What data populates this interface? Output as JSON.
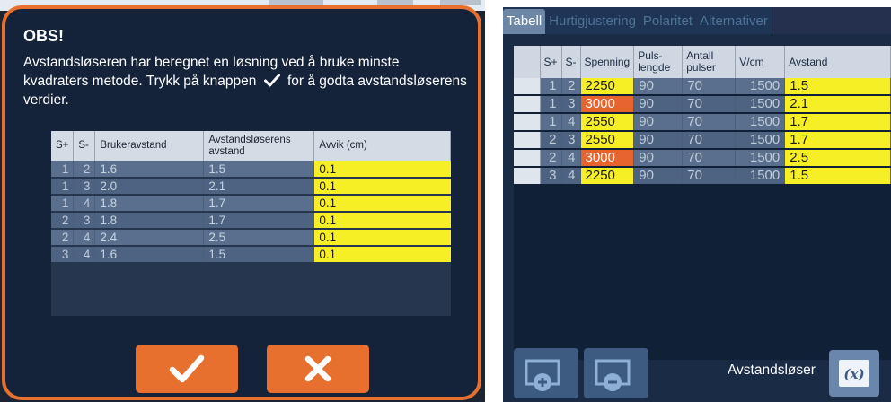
{
  "dialog": {
    "title": "OBS!",
    "message_part1": "Avstandsløseren har beregnet en løsning ved å bruke minste kvadraters metode. Trykk på knappen",
    "message_part2": "for å godta avstandsløserens verdier.",
    "table": {
      "headers": [
        "S+",
        "S-",
        "Brukeravstand",
        "Avstandsløserens avstand",
        "Avvik (cm)"
      ],
      "rows": [
        {
          "splus": "1",
          "sminus": "2",
          "user": "1.6",
          "solver": "1.5",
          "dev": "0.1"
        },
        {
          "splus": "1",
          "sminus": "3",
          "user": "2.0",
          "solver": "2.1",
          "dev": "0.1"
        },
        {
          "splus": "1",
          "sminus": "4",
          "user": "1.8",
          "solver": "1.7",
          "dev": "0.1"
        },
        {
          "splus": "2",
          "sminus": "3",
          "user": "1.8",
          "solver": "1.7",
          "dev": "0.1"
        },
        {
          "splus": "2",
          "sminus": "4",
          "user": "2.4",
          "solver": "2.5",
          "dev": "0.1"
        },
        {
          "splus": "3",
          "sminus": "4",
          "user": "1.6",
          "solver": "1.5",
          "dev": "0.1"
        }
      ]
    },
    "ok_icon": "checkmark-icon",
    "cancel_icon": "x-icon"
  },
  "app": {
    "tabs": [
      "Tabell",
      "Hurtigjustering",
      "Polaritet",
      "Alternativer"
    ],
    "active_tab": "Tabell",
    "table": {
      "headers": [
        "",
        "S+",
        "S-",
        "Spenning",
        "Puls-lengde",
        "Antall pulser",
        "V/cm",
        "Avstand"
      ],
      "rows": [
        {
          "splus": "1",
          "sminus": "2",
          "voltage": "2250",
          "voltage_status": "yellow",
          "pulse_length": "90",
          "pulses": "70",
          "vcm": "1500",
          "distance": "1.5"
        },
        {
          "splus": "1",
          "sminus": "3",
          "voltage": "3000",
          "voltage_status": "orange",
          "pulse_length": "90",
          "pulses": "70",
          "vcm": "1500",
          "distance": "2.1"
        },
        {
          "splus": "1",
          "sminus": "4",
          "voltage": "2550",
          "voltage_status": "yellow",
          "pulse_length": "90",
          "pulses": "70",
          "vcm": "1500",
          "distance": "1.7"
        },
        {
          "splus": "2",
          "sminus": "3",
          "voltage": "2550",
          "voltage_status": "yellow",
          "pulse_length": "90",
          "pulses": "70",
          "vcm": "1500",
          "distance": "1.7"
        },
        {
          "splus": "2",
          "sminus": "4",
          "voltage": "3000",
          "voltage_status": "orange",
          "pulse_length": "90",
          "pulses": "70",
          "vcm": "1500",
          "distance": "2.5"
        },
        {
          "splus": "3",
          "sminus": "4",
          "voltage": "2250",
          "voltage_status": "yellow",
          "pulse_length": "90",
          "pulses": "70",
          "vcm": "1500",
          "distance": "1.5"
        }
      ]
    },
    "bottom": {
      "add_icon": "add-pair-icon",
      "remove_icon": "remove-pair-icon",
      "solver_label": "Avstandsløser",
      "solver_icon": "function-x-icon"
    }
  },
  "colors": {
    "accent_orange": "#e8702e",
    "highlight_yellow": "#f6ef25",
    "dialog_bg": "#14233a",
    "app_bg": "#1a2b45"
  }
}
